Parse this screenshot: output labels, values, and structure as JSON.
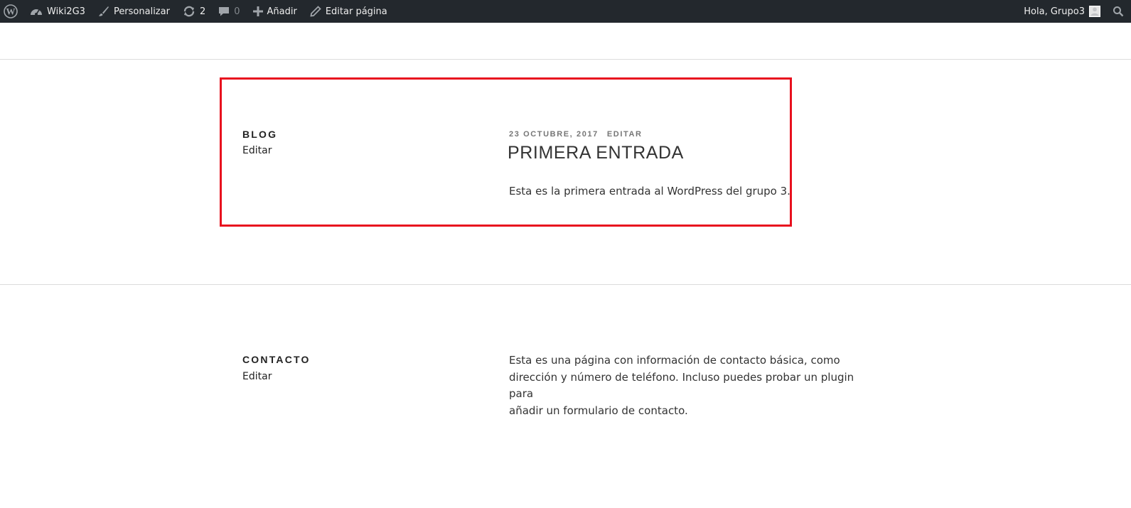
{
  "adminbar": {
    "wp_logo_icon": "wordpress-icon",
    "site_name": "Wiki2G3",
    "customize_label": "Personalizar",
    "updates_count": "2",
    "comments_count": "0",
    "new_label": "Añadir",
    "edit_page_label": "Editar página",
    "greeting": "Hola, Grupo3"
  },
  "blog_panel": {
    "title": "BLOG",
    "edit_label": "Editar",
    "highlight_color": "#e8101e",
    "post": {
      "date": "23 OCTUBRE, 2017",
      "edit_label": "EDITAR",
      "title": "PRIMERA ENTRADA",
      "excerpt": "Esta es la primera entrada al WordPress del grupo 3."
    }
  },
  "contact_panel": {
    "title": "CONTACTO",
    "edit_label": "Editar",
    "text_lines": [
      "Esta es una página con información de contacto básica, como",
      "dirección y número de teléfono. Incluso puedes probar un plugin para",
      "añadir un formulario de contacto."
    ]
  }
}
